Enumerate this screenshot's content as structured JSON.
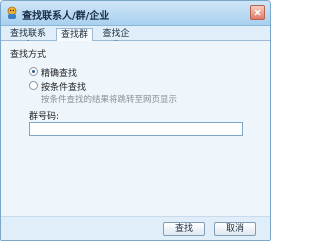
{
  "window": {
    "title": "查找联系人/群/企业"
  },
  "tabs": [
    {
      "label": "查找联系人",
      "active": false
    },
    {
      "label": "查找群",
      "active": true
    },
    {
      "label": "查找企业",
      "active": false
    }
  ],
  "search": {
    "section_label": "查找方式",
    "options": [
      {
        "label": "精确查找",
        "checked": true
      },
      {
        "label": "按条件查找",
        "checked": false
      }
    ],
    "condition_hint": "按条件查找的结果将跳转至网页显示",
    "field_label": "群号码:",
    "field_value": "",
    "field_placeholder": ""
  },
  "footer": {
    "search_label": "查找",
    "cancel_label": "取消"
  },
  "colors": {
    "window_bg": "#dfeef9",
    "titlebar_top": "#cfe6f8",
    "titlebar_bottom": "#a9d0ef",
    "close_button": "#dd7b66",
    "input_border": "#7ea6c7"
  },
  "icons": [
    "app-icon",
    "close-icon"
  ]
}
